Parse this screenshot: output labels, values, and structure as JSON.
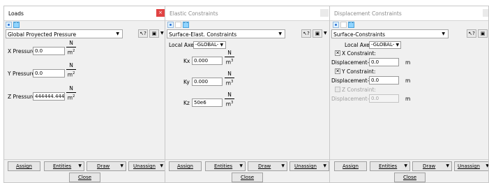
{
  "loads": {
    "title": "Loads",
    "close_x": "×",
    "combo": "Global Proyected Pressure",
    "fields": [
      {
        "label": "X Pressure",
        "value": "0.0",
        "unit_num": "N",
        "unit_den": "m",
        "unit_exp": "2"
      },
      {
        "label": "Y Pressure",
        "value": "0.0",
        "unit_num": "N",
        "unit_den": "m",
        "unit_exp": "2"
      },
      {
        "label": "Z Pressure",
        "value": "444444.444",
        "unit_num": "N",
        "unit_den": "m",
        "unit_exp": "2"
      }
    ],
    "buttons": {
      "assign": "Assign",
      "entities": "Entities",
      "draw": "Draw",
      "unassign": "Unassign",
      "close": "Close"
    }
  },
  "elastic": {
    "title": "Elastic Constraints",
    "combo": "Surface-Elast. Constraints",
    "local_axes_label": "Local Axes",
    "local_axes_value": "-GLOBAL-",
    "fields": [
      {
        "label": "Kx",
        "value": "0.000",
        "unit_num": "N",
        "unit_den": "m",
        "unit_exp": "3"
      },
      {
        "label": "Ky",
        "value": "0.000",
        "unit_num": "N",
        "unit_den": "m",
        "unit_exp": "3"
      },
      {
        "label": "Kz",
        "value": "50e6",
        "unit_num": "N",
        "unit_den": "m",
        "unit_exp": "3"
      }
    ],
    "buttons": {
      "assign": "Assign",
      "entities": "Entities",
      "draw": "Draw",
      "unassign": "Unassign",
      "close": "Close"
    }
  },
  "displacement": {
    "title": "Displacement Constraints",
    "combo": "Surface-Constraints",
    "local_axes_label": "Local Axes",
    "local_axes_value": "-GLOBAL-",
    "constraints": [
      {
        "check_label": "X Constraint:",
        "field_label": "Displacement-X",
        "value": "0.0",
        "unit": "m",
        "checked": "true",
        "enabled": "true"
      },
      {
        "check_label": "Y Constraint:",
        "field_label": "Displacement-Y",
        "value": "0.0",
        "unit": "m",
        "checked": "true",
        "enabled": "true"
      },
      {
        "check_label": "Z Constraint:",
        "field_label": "Displacement-Z",
        "value": "0.0",
        "unit": "m",
        "checked": "false",
        "enabled": "false"
      }
    ],
    "buttons": {
      "assign": "Assign",
      "entities": "Entities",
      "draw": "Draw",
      "unassign": "Unassign",
      "close": "Close"
    }
  },
  "glyphs": {
    "arrow_down": "▼",
    "check_mark": "✕",
    "help": "?",
    "help_arrow": "↖",
    "book": "▣"
  }
}
